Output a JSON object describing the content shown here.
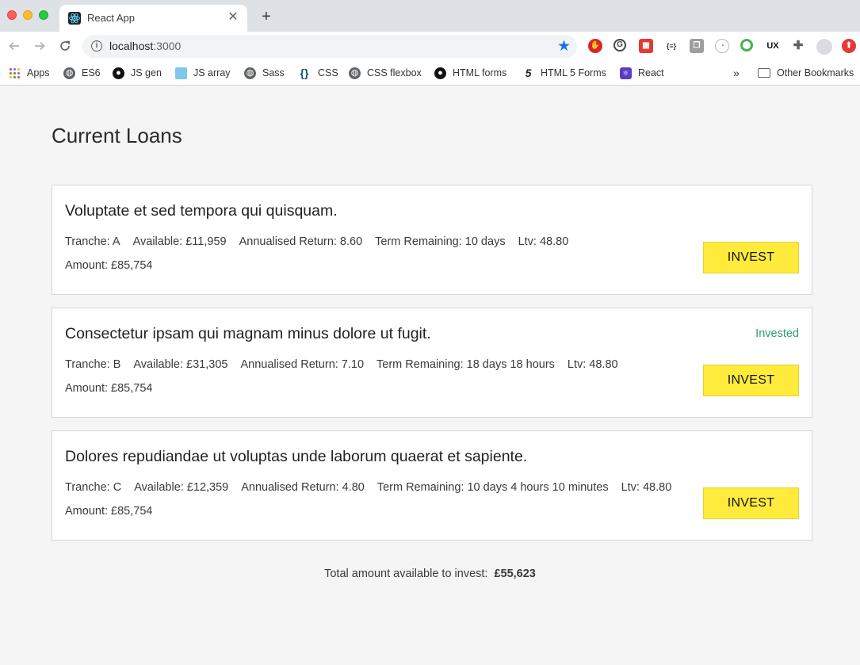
{
  "browser": {
    "tab_title": "React App",
    "new_tab": "+",
    "close_glyph": "✕",
    "url_host": "localhost",
    "url_port": ":3000",
    "bookmarks": [
      {
        "label": "Apps",
        "icon": "apps-icon"
      },
      {
        "label": "ES6",
        "icon": "globe-icon"
      },
      {
        "label": "JS gen",
        "icon": "github-icon"
      },
      {
        "label": "JS array",
        "icon": "turtle-icon"
      },
      {
        "label": "Sass",
        "icon": "globe-icon"
      },
      {
        "label": "CSS",
        "icon": "braces-icon"
      },
      {
        "label": "CSS flexbox",
        "icon": "globe-icon"
      },
      {
        "label": "HTML forms",
        "icon": "github-icon"
      },
      {
        "label": "HTML 5 Forms",
        "icon": "five-icon"
      },
      {
        "label": "React",
        "icon": "react-icon"
      }
    ],
    "more_bookmarks": "»",
    "other_bookmarks": "Other Bookmarks",
    "extensions": [
      "adblock-icon",
      "grammarly-icon",
      "ext-red-icon",
      "json-icon",
      "copy-icon",
      "timer-icon",
      "speed-icon",
      "ux-icon",
      "puzzle-icon",
      "profile-icon",
      "update-icon"
    ]
  },
  "page": {
    "title": "Current Loans",
    "loans": [
      {
        "title": "Voluptate et sed tempora qui quisquam.",
        "tranche": "Tranche: A",
        "available": "Available: £11,959",
        "annualised_return": "Annualised Return: 8.60",
        "term_remaining": "Term Remaining: 10 days",
        "ltv": "Ltv: 48.80",
        "amount": "Amount: £85,754",
        "invested_label": "",
        "button_label": "INVEST"
      },
      {
        "title": "Consectetur ipsam qui magnam minus dolore ut fugit.",
        "tranche": "Tranche: B",
        "available": "Available: £31,305",
        "annualised_return": "Annualised Return: 7.10",
        "term_remaining": "Term Remaining: 18 days 18 hours",
        "ltv": "Ltv: 48.80",
        "amount": "Amount: £85,754",
        "invested_label": "Invested",
        "button_label": "INVEST"
      },
      {
        "title": "Dolores repudiandae ut voluptas unde laborum quaerat et sapiente.",
        "tranche": "Tranche: C",
        "available": "Available: £12,359",
        "annualised_return": "Annualised Return: 4.80",
        "term_remaining": "Term Remaining: 10 days 4 hours 10 minutes",
        "ltv": "Ltv: 48.80",
        "amount": "Amount: £85,754",
        "invested_label": "",
        "button_label": "INVEST"
      }
    ],
    "total_label": "Total amount available to invest:",
    "total_value": "£55,623"
  },
  "colors": {
    "invest_button": "#ffeb3b",
    "invested_text": "#2e9d6b",
    "page_background": "#f5f5f5"
  }
}
